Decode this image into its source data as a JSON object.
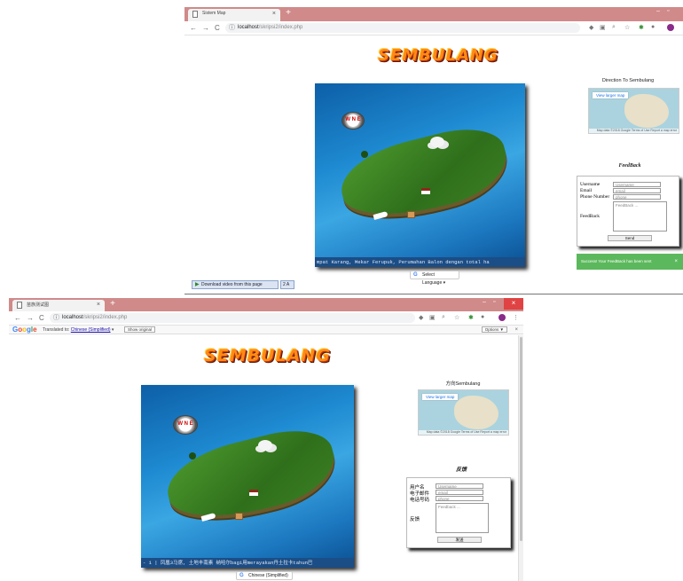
{
  "top": {
    "tab_title": "Sistem Map",
    "url_host": "localhost",
    "url_path": "/skripsi2/index.php",
    "logo": "SEMBULANG",
    "marquee": "mpat Karang, Mekar Ferupuk, Perumahan Balon dengan total ha",
    "map_heading": "Direction To Sembulang",
    "view_larger_map": "View larger map",
    "map_footer": "Map data ©2018 Google   Terms of Use   Report a map error",
    "feedback_title": "FeedBack",
    "form": {
      "username_label": "Username",
      "email_label": "Email",
      "phone_label": "Phone Number",
      "feedback_label": "FeedBack",
      "username_placeholder": "Username",
      "email_placeholder": "email",
      "phone_placeholder": "phone",
      "feedback_placeholder": "FeedBack ...",
      "send": "Send"
    },
    "translate_widget": "Select Language",
    "toast": "Success! Your FeedBack has been sent",
    "toast_close": "×",
    "download_bar": "Download video from this page",
    "download_extra": "2 A"
  },
  "bottom": {
    "tab_title": "苗族测试图",
    "url_host": "localhost",
    "url_path": "/skripsi2/index.php",
    "google_label": "Google",
    "translated_to": "Translated to:",
    "target_language": "Chinese (Simplified)",
    "show_original": "Show original",
    "options": "Options ▼",
    "bar_close": "×",
    "logo": "SEMBULANG",
    "marquee": "- 1 | 凤凰3马席, 土地丰南素 纳哈尔bagi用merayakan丹土拉卡tahun巴",
    "map_heading": "方向Sembulang",
    "view_larger_map": "View larger map",
    "map_footer": "Map data ©2018 Google   Terms of Use   Report a map error",
    "feedback_title": "反馈",
    "form": {
      "username_label": "用户名",
      "email_label": "电子邮件",
      "phone_label": "电话号码",
      "feedback_label": "反馈",
      "username_placeholder": "Username",
      "email_placeholder": "email",
      "phone_placeholder": "phone",
      "feedback_placeholder": "Feedback ...",
      "send": "发送"
    },
    "translate_widget": "Chinese (Simplified)"
  },
  "colors": {
    "tabbar": "#d08a8a",
    "logo_orange": "#ff8a14",
    "toast_green": "#5cb85c",
    "sea_blue": "#1e8ad1"
  },
  "icons": [
    "back-arrow-icon",
    "forward-arrow-icon",
    "reload-icon",
    "info-icon",
    "star-icon",
    "close-icon",
    "compass-icon",
    "play-icon",
    "google-g-icon"
  ]
}
